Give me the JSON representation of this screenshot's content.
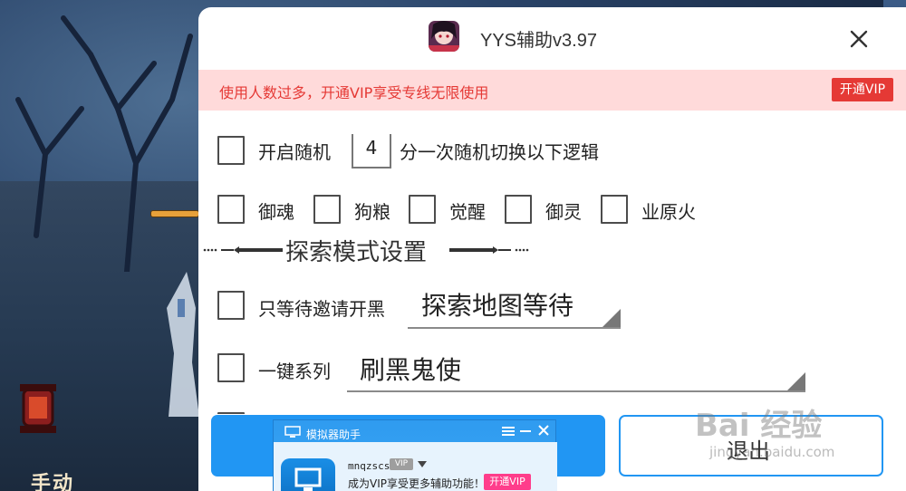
{
  "dialog": {
    "title": "YYS辅助v3.97",
    "notice": "使用人数过多，开通VIP享受专线无限使用",
    "vip_button": "开通VIP"
  },
  "random_mode": {
    "prefix": "开启随机",
    "minutes": "4",
    "suffix": "分一次随机切换以下逻辑"
  },
  "modes": [
    "御魂",
    "狗粮",
    "觉醒",
    "御灵",
    "业原火"
  ],
  "section_title": "探索模式设置",
  "invite_option": {
    "label": "只等待邀请开黑",
    "dropdown_value": "探索地图等待"
  },
  "series_option": {
    "label": "一键系列",
    "dropdown_value": "刷黑鬼使"
  },
  "buttons": {
    "exit": "退出"
  },
  "game": {
    "mode_button": "手动"
  },
  "helper": {
    "title": "模拟器助手",
    "username": "mnqzscs",
    "tag": "VIP",
    "message": "成为VIP享受更多辅助功能！",
    "vip_button": "开通VIP"
  },
  "watermark": {
    "main": "Bai 经验",
    "sub": "jingyan.baidu.com"
  },
  "colors": {
    "primary_blue": "#2196f3",
    "notice_red": "#e53935",
    "notice_bg": "#ffdada"
  }
}
